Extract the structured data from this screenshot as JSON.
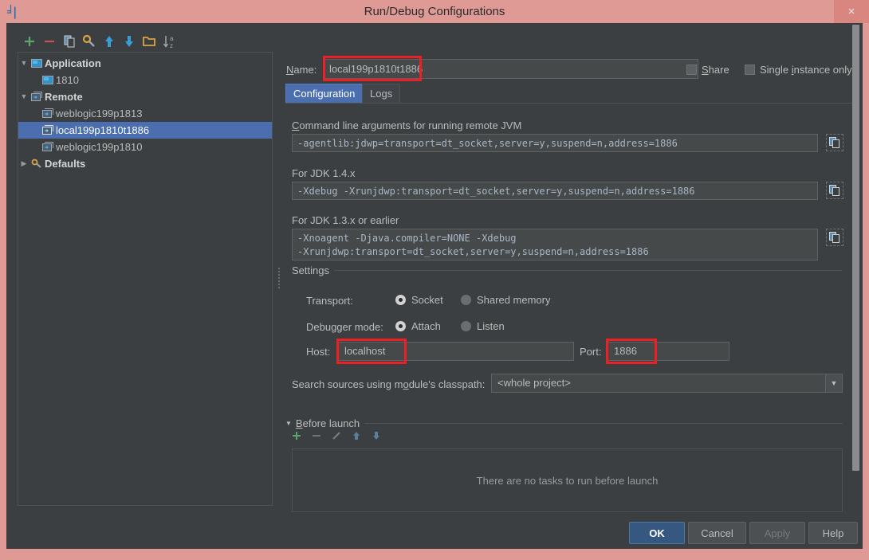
{
  "window": {
    "title": "Run/Debug Configurations",
    "app_icon": "intellij-idea-icon",
    "close_label": "×",
    "accent_red": "#ec2024",
    "titlebar_color": "#e09a96",
    "panel_color": "#3c3f41",
    "selection_color": "#4b6eaf"
  },
  "tree_toolbar": {
    "items": [
      {
        "name": "add-configuration-button",
        "icon": "plus-icon",
        "tooltip": "Add New Configuration"
      },
      {
        "name": "remove-configuration-button",
        "icon": "minus-icon",
        "tooltip": "Remove Configuration"
      },
      {
        "name": "copy-configuration-button",
        "icon": "copy-icon",
        "tooltip": "Copy Configuration"
      },
      {
        "name": "edit-defaults-button",
        "icon": "wrench-icon",
        "tooltip": "Edit defaults"
      },
      {
        "name": "move-up-button",
        "icon": "arrow-up-icon",
        "tooltip": "Move Up"
      },
      {
        "name": "move-down-button",
        "icon": "arrow-down-icon",
        "tooltip": "Move Down"
      },
      {
        "name": "create-folder-button",
        "icon": "folder-icon",
        "tooltip": "Create New Folder"
      },
      {
        "name": "sort-configurations-button",
        "icon": "sort-alpha-icon",
        "tooltip": "Sort Configurations"
      }
    ]
  },
  "tree": {
    "nodes": [
      {
        "label": "Application",
        "type": "group",
        "expanded": true,
        "icon": "application-icon",
        "selected": false
      },
      {
        "label": "1810",
        "type": "child",
        "icon": "application-icon",
        "selected": false
      },
      {
        "label": "Remote",
        "type": "group",
        "expanded": true,
        "icon": "remote-icon",
        "selected": false
      },
      {
        "label": "weblogic199p1813",
        "type": "child",
        "icon": "remote-icon",
        "selected": false
      },
      {
        "label": "local199p1810t1886",
        "type": "child",
        "icon": "remote-icon",
        "selected": true
      },
      {
        "label": "weblogic199p1810",
        "type": "child",
        "icon": "remote-icon",
        "selected": false
      },
      {
        "label": "Defaults",
        "type": "group",
        "expanded": false,
        "icon": "defaults-icon",
        "selected": false
      }
    ]
  },
  "header": {
    "name_label": "Name:",
    "name_value": "local199p1810t1886",
    "share_label": "Share",
    "share_checked": false,
    "single_instance_label": "Single instance only",
    "single_instance_checked": false
  },
  "tabs": [
    {
      "label": "Configuration",
      "active": true
    },
    {
      "label": "Logs",
      "active": false
    }
  ],
  "configuration": {
    "cmdline_label": "Command line arguments for running remote JVM",
    "cmdline_value": "-agentlib:jdwp=transport=dt_socket,server=y,suspend=n,address=1886",
    "jdk14_label": "For JDK 1.4.x",
    "jdk14_value": "-Xdebug -Xrunjdwp:transport=dt_socket,server=y,suspend=n,address=1886",
    "jdk13_label": "For JDK 1.3.x or earlier",
    "jdk13_value": "-Xnoagent -Djava.compiler=NONE -Xdebug\n-Xrunjdwp:transport=dt_socket,server=y,suspend=n,address=1886",
    "copy_icon": "copy-to-clipboard-icon",
    "settings_title": "Settings",
    "transport_label": "Transport:",
    "transport_options": [
      {
        "label": "Socket",
        "selected": true
      },
      {
        "label": "Shared memory",
        "selected": false
      }
    ],
    "debugger_mode_label": "Debugger mode:",
    "debugger_mode_options": [
      {
        "label": "Attach",
        "selected": true
      },
      {
        "label": "Listen",
        "selected": false
      }
    ],
    "host_label": "Host:",
    "host_value": "localhost",
    "port_label": "Port:",
    "port_value": "1886",
    "classpath_label": "Search sources using module's classpath:",
    "classpath_value": "<whole project>",
    "classpath_arrow": "▼"
  },
  "before_launch": {
    "title": "Before launch",
    "expanded": true,
    "arrow": "▼",
    "toolbar": [
      {
        "name": "add-task-button",
        "icon": "plus-icon"
      },
      {
        "name": "remove-task-button",
        "icon": "minus-icon"
      },
      {
        "name": "edit-task-button",
        "icon": "pencil-icon"
      },
      {
        "name": "move-task-up-button",
        "icon": "arrow-up-icon"
      },
      {
        "name": "move-task-down-button",
        "icon": "arrow-down-icon"
      }
    ],
    "empty_text": "There are no tasks to run before launch"
  },
  "buttons": [
    {
      "label": "OK",
      "style": "primary",
      "enabled": true
    },
    {
      "label": "Cancel",
      "style": "normal",
      "enabled": true
    },
    {
      "label": "Apply",
      "style": "disabled",
      "enabled": false
    },
    {
      "label": "Help",
      "style": "normal",
      "enabled": true
    }
  ]
}
